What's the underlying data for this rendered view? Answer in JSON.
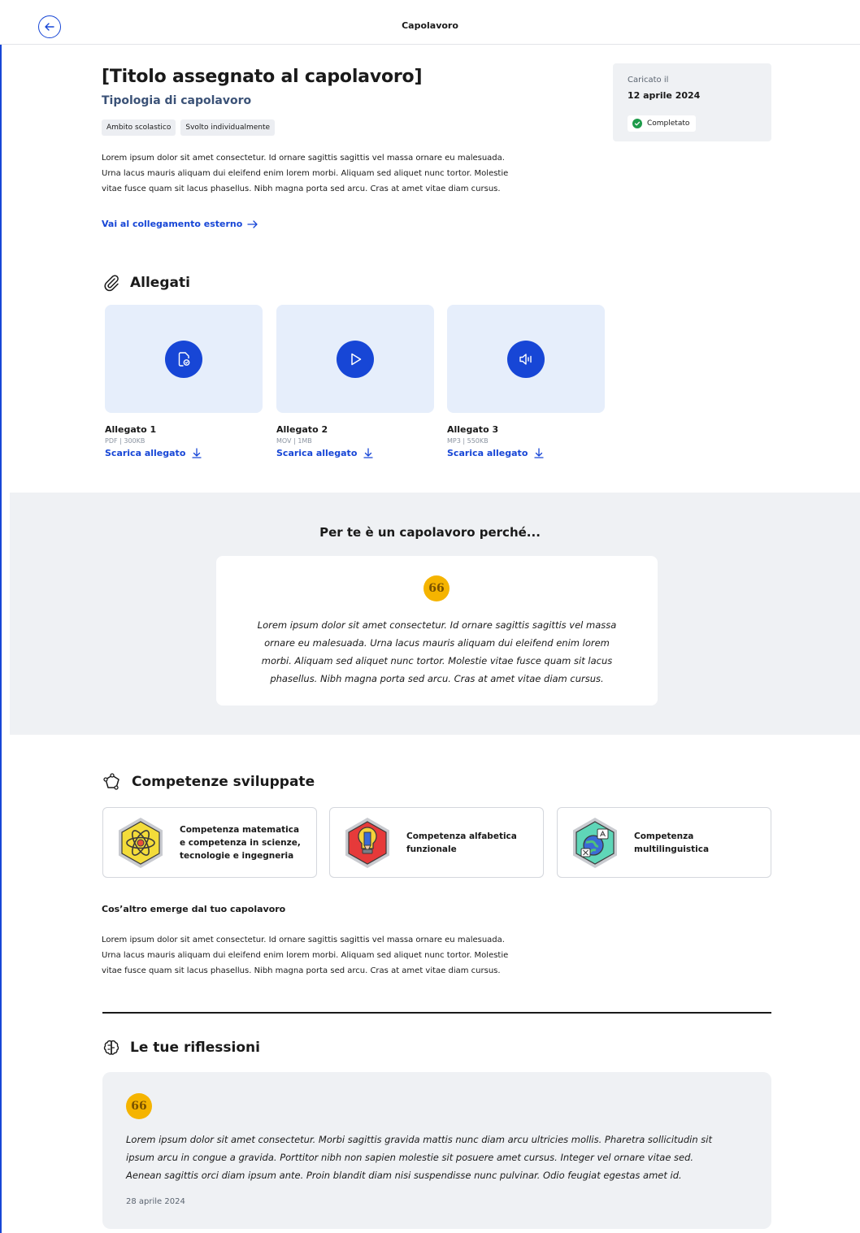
{
  "header": {
    "title": "Capolavoro",
    "back_icon": "arrow-left-icon"
  },
  "work": {
    "title": "[Titolo assegnato al capolavoro]",
    "type": "Tipologia di capolavoro",
    "tags": [
      "Ambito scolastico",
      "Svolto individualmente"
    ],
    "description_lines": [
      "Lorem ipsum dolor sit amet consectetur. Id ornare sagittis sagittis vel massa ornare eu malesuada.",
      "Urna lacus mauris aliquam dui eleifend enim lorem morbi. Aliquam sed aliquet nunc tortor. Molestie",
      "vitae fusce quam sit lacus phasellus. Nibh magna porta sed arcu. Cras at amet vitae diam cursus."
    ],
    "external_link": "Vai al collegamento esterno"
  },
  "status": {
    "uploaded_label": "Caricato il",
    "uploaded_date": "12 aprile 2024",
    "state": "Completato",
    "state_color": "#1d9b4a"
  },
  "attachments": {
    "heading": "Allegati",
    "items": [
      {
        "name": "Allegato 1",
        "meta": "PDF | 300KB",
        "download": "Scarica allegato",
        "icon": "document-icon"
      },
      {
        "name": "Allegato 2",
        "meta": "MOV | 1MB",
        "download": "Scarica allegato",
        "icon": "play-icon"
      },
      {
        "name": "Allegato 3",
        "meta": "MP3 | 550KB",
        "download": "Scarica allegato",
        "icon": "audio-icon"
      }
    ]
  },
  "why": {
    "heading": "Per te è un capolavoro perché...",
    "quote_mark": "66",
    "lines": [
      "Lorem ipsum dolor sit amet consectetur. Id ornare sagittis sagittis vel massa",
      "ornare eu malesuada. Urna lacus mauris aliquam dui eleifend enim lorem",
      "morbi. Aliquam sed aliquet nunc tortor. Molestie vitae fusce quam sit lacus",
      "phasellus. Nibh magna porta sed arcu. Cras at amet vitae diam cursus."
    ]
  },
  "competences": {
    "heading": "Competenze sviluppate",
    "items": [
      {
        "lines": [
          "Competenza matematica",
          "e competenza in scienze,",
          "tecnologie e ingegneria"
        ],
        "icon": "atom-badge-icon"
      },
      {
        "lines": [
          "Competenza alfabetica",
          "funzionale"
        ],
        "icon": "pencil-badge-icon"
      },
      {
        "lines": [
          "Competenza",
          "multilinguistica"
        ],
        "icon": "globe-badge-icon"
      }
    ]
  },
  "emerge": {
    "heading": "Cos’altro emerge dal tuo capolavoro",
    "lines": [
      "Lorem ipsum dolor sit amet consectetur. Id ornare sagittis sagittis vel massa ornare eu malesuada.",
      "Urna lacus mauris aliquam dui eleifend enim lorem morbi. Aliquam sed aliquet nunc tortor. Molestie",
      "vitae fusce quam sit lacus phasellus. Nibh magna porta sed arcu. Cras at amet vitae diam cursus."
    ]
  },
  "reflections": {
    "heading": "Le tue riflessioni",
    "quote_mark": "66",
    "lines": [
      "Lorem ipsum dolor sit amet consectetur. Morbi sagittis gravida mattis nunc diam arcu ultricies mollis. Pharetra sollicitudin sit",
      "ipsum arcu in congue a gravida. Porttitor nibh non sapien molestie sit posuere amet cursus. Integer vel ornare vitae sed.",
      "Aenean sagittis orci diam ipsum ante. Proin blandit diam nisi suspendisse nunc pulvinar. Odio feugiat egestas amet id."
    ],
    "date": "28 aprile 2024"
  },
  "colors": {
    "accent": "#1746d6",
    "quote": "#f5b400",
    "panel": "#eff1f4",
    "attachment_bg": "#e6eefb"
  }
}
